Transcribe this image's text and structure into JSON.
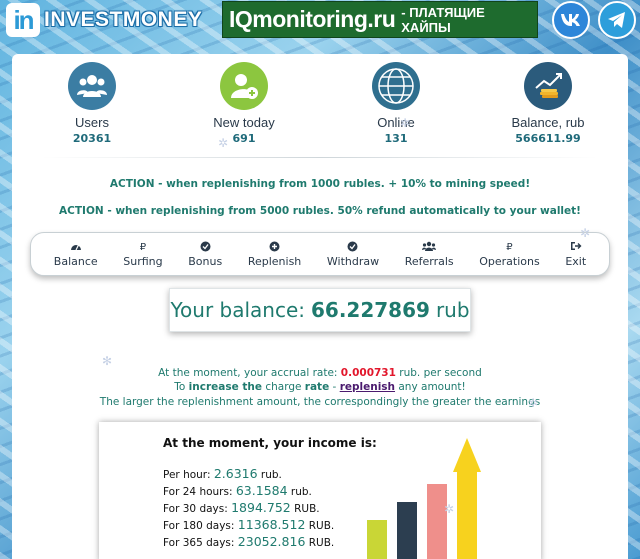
{
  "header": {
    "logo_letters": "in",
    "logo_text": "INVESTMONEY",
    "banner_main": "IQmonitoring.ru",
    "banner_sub": "- ПЛАТЯЩИЕ ХАЙПЫ",
    "social": [
      "vk-icon",
      "telegram-icon"
    ]
  },
  "stats": [
    {
      "label": "Users",
      "value": "20361",
      "icon": "users-icon",
      "color": "#3b7da3"
    },
    {
      "label": "New today",
      "value": "691",
      "icon": "user-add-icon",
      "color": "#8cc63f"
    },
    {
      "label": "Online",
      "value": "131",
      "icon": "globe-icon",
      "color": "#2f6f8f"
    },
    {
      "label": "Balance, rub",
      "value": "566611.99",
      "icon": "money-chart-icon",
      "color": "#2b5b7c"
    }
  ],
  "promo": [
    "ACTION - when replenishing from 1000 rubles. + 10% to mining speed!",
    "ACTION - when replenishing from 5000 rubles. 50% refund automatically to your wallet!"
  ],
  "nav": [
    {
      "label": "Balance",
      "icon": "dashboard-icon"
    },
    {
      "label": "Surfing",
      "icon": "ruble-icon"
    },
    {
      "label": "Bonus",
      "icon": "check-circle-icon"
    },
    {
      "label": "Replenish",
      "icon": "plus-circle-icon"
    },
    {
      "label": "Withdraw",
      "icon": "check-circle-icon"
    },
    {
      "label": "Referrals",
      "icon": "group-icon"
    },
    {
      "label": "Operations",
      "icon": "ruble-icon"
    },
    {
      "label": "Exit",
      "icon": "sign-out-icon"
    }
  ],
  "balance": {
    "prefix": "Your balance:",
    "amount": "66.227869",
    "unit": "rub"
  },
  "info": {
    "line1_pre": "At the moment, your accrual rate:",
    "rate": "0.000731",
    "line1_post": "rub. per second",
    "line2_a": "To",
    "line2_b": "increase the",
    "line2_c": "charge",
    "line2_d": "rate",
    "line2_e": "-",
    "link": "replenish",
    "line2_f": "any amount!",
    "line3": "The larger the replenishment amount, the correspondingly the greater the earnings"
  },
  "income": {
    "title": "At the moment, your income is:",
    "rows": [
      {
        "label": "Per hour:",
        "value": "2.6316",
        "unit": "rub."
      },
      {
        "label": "For 24 hours:",
        "value": "63.1584",
        "unit": "rub."
      },
      {
        "label": "For 30 days:",
        "value": "1894.752",
        "unit": "RUB."
      },
      {
        "label": "For 180 days:",
        "value": "11368.512",
        "unit": "RUB."
      },
      {
        "label": "For 365 days:",
        "value": "23052.816",
        "unit": "RUB."
      }
    ],
    "bar_colors": [
      "#c9d636",
      "#2c3e50",
      "#ef8f8b",
      "#f7d21e"
    ],
    "arrow_color": "#f7d21e"
  }
}
